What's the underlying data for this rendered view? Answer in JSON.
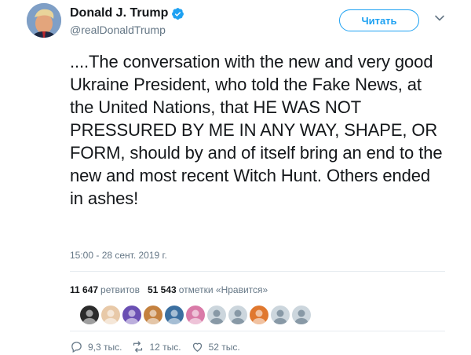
{
  "author": {
    "display_name": "Donald J. Trump",
    "handle": "@realDonaldTrump",
    "verified": true,
    "avatar_icon": "profile-photo"
  },
  "follow_button": {
    "label": "Читать"
  },
  "tweet": {
    "text": "....The conversation with the new and very good Ukraine President, who told the Fake News, at the United Nations, that HE WAS NOT PRESSURED BY ME IN ANY WAY, SHAPE, OR FORM, should by and of itself bring an end to the new and most recent Witch Hunt. Others ended in ashes!",
    "timestamp": "15:00 - 28 сент. 2019 г."
  },
  "stats": {
    "retweets_count": "11 647",
    "retweets_label": "ретвитов",
    "likes_count": "51 543",
    "likes_label": "отметки «Нравится»"
  },
  "likers": [
    {
      "color": "#2b2b2b",
      "icon": "avatar"
    },
    {
      "color": "#e8c9a8",
      "icon": "avatar"
    },
    {
      "color": "#6a4fb3",
      "icon": "avatar"
    },
    {
      "color": "#c4813f",
      "icon": "avatar"
    },
    {
      "color": "#3b6fa0",
      "icon": "avatar"
    },
    {
      "color": "#d97aa8",
      "icon": "avatar"
    },
    {
      "color": "#ccd6dd",
      "icon": "default-avatar"
    },
    {
      "color": "#ccd6dd",
      "icon": "default-avatar"
    },
    {
      "color": "#e0782f",
      "icon": "avatar"
    },
    {
      "color": "#ccd6dd",
      "icon": "default-avatar"
    },
    {
      "color": "#ccd6dd",
      "icon": "default-avatar"
    }
  ],
  "actions": {
    "reply_count": "9,3 тыс.",
    "retweet_count": "12 тыс.",
    "like_count": "52 тыс."
  },
  "colors": {
    "accent": "#1da1f2",
    "secondary_text": "#657786",
    "primary_text": "#14171a"
  }
}
